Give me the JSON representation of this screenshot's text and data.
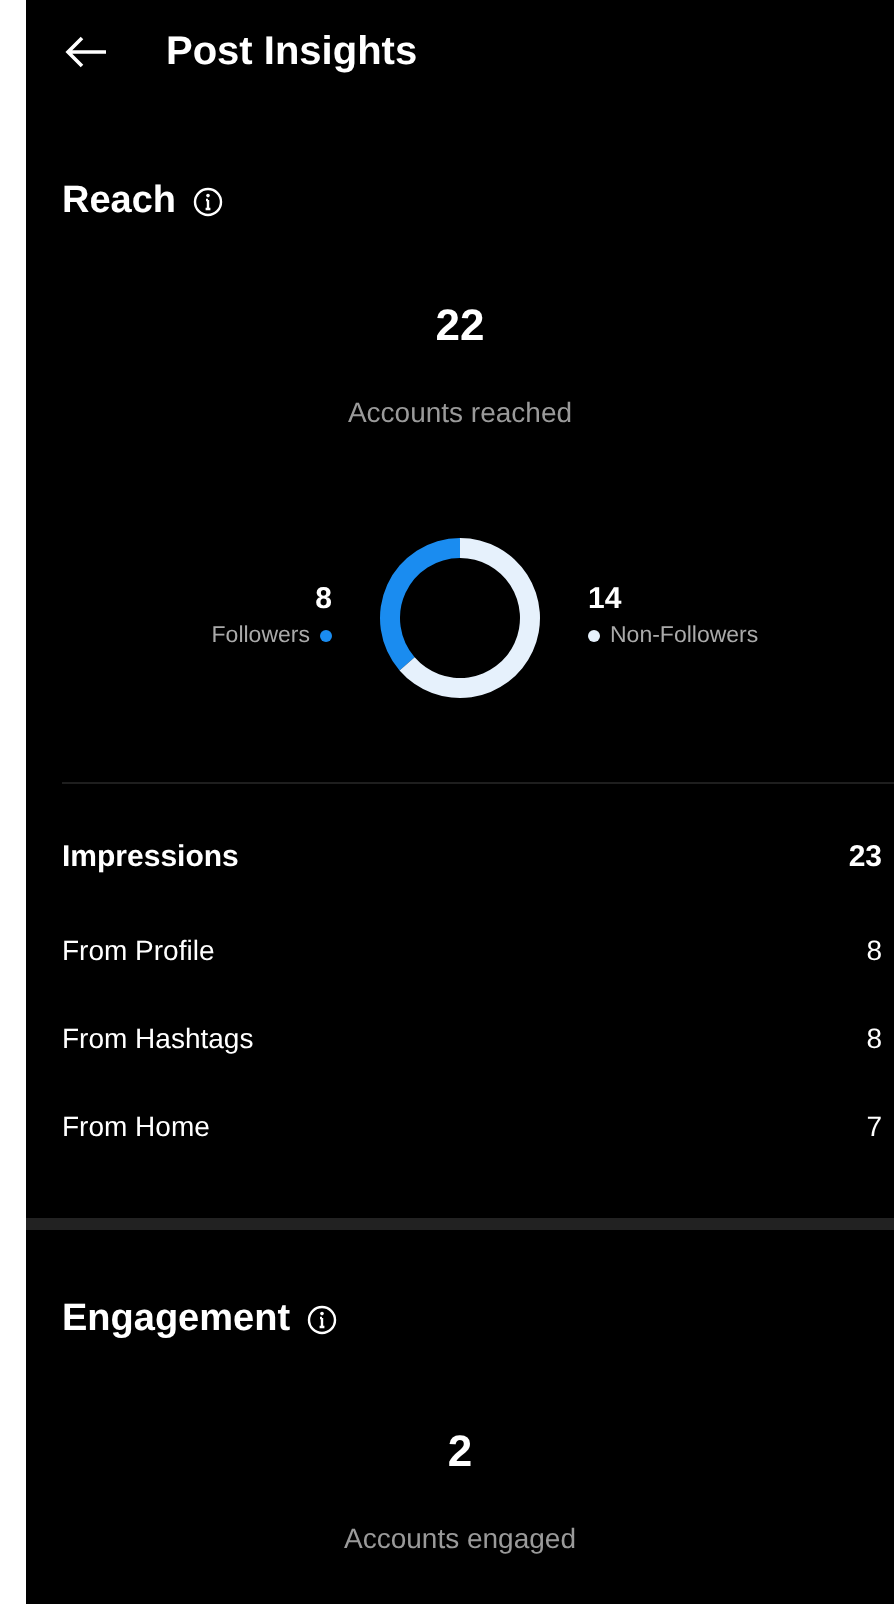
{
  "header": {
    "title": "Post Insights"
  },
  "reach": {
    "title": "Reach",
    "total": "22",
    "legend": [
      {
        "color": "#1a8cf0"
      },
      {
        "color": "#e6f1fc"
      }
    ],
    "chart_data": {
      "type": "donut",
      "categories": [
        "Followers",
        "Non-Followers"
      ],
      "series": [
        {
          "name": "Accounts reached",
          "values": [
            8,
            14
          ]
        }
      ],
      "data_labels": true
    }
  },
  "impressions": {
    "title": "Impressions",
    "total": "23",
    "rows": [
      {
        "label": "From Profile",
        "value": "8"
      },
      {
        "label": "From Hashtags",
        "value": "8"
      },
      {
        "label": "From Home",
        "value": "7"
      }
    ]
  },
  "engagement": {
    "title": "Engagement",
    "total": "2",
    "caption": "Accounts engaged"
  }
}
